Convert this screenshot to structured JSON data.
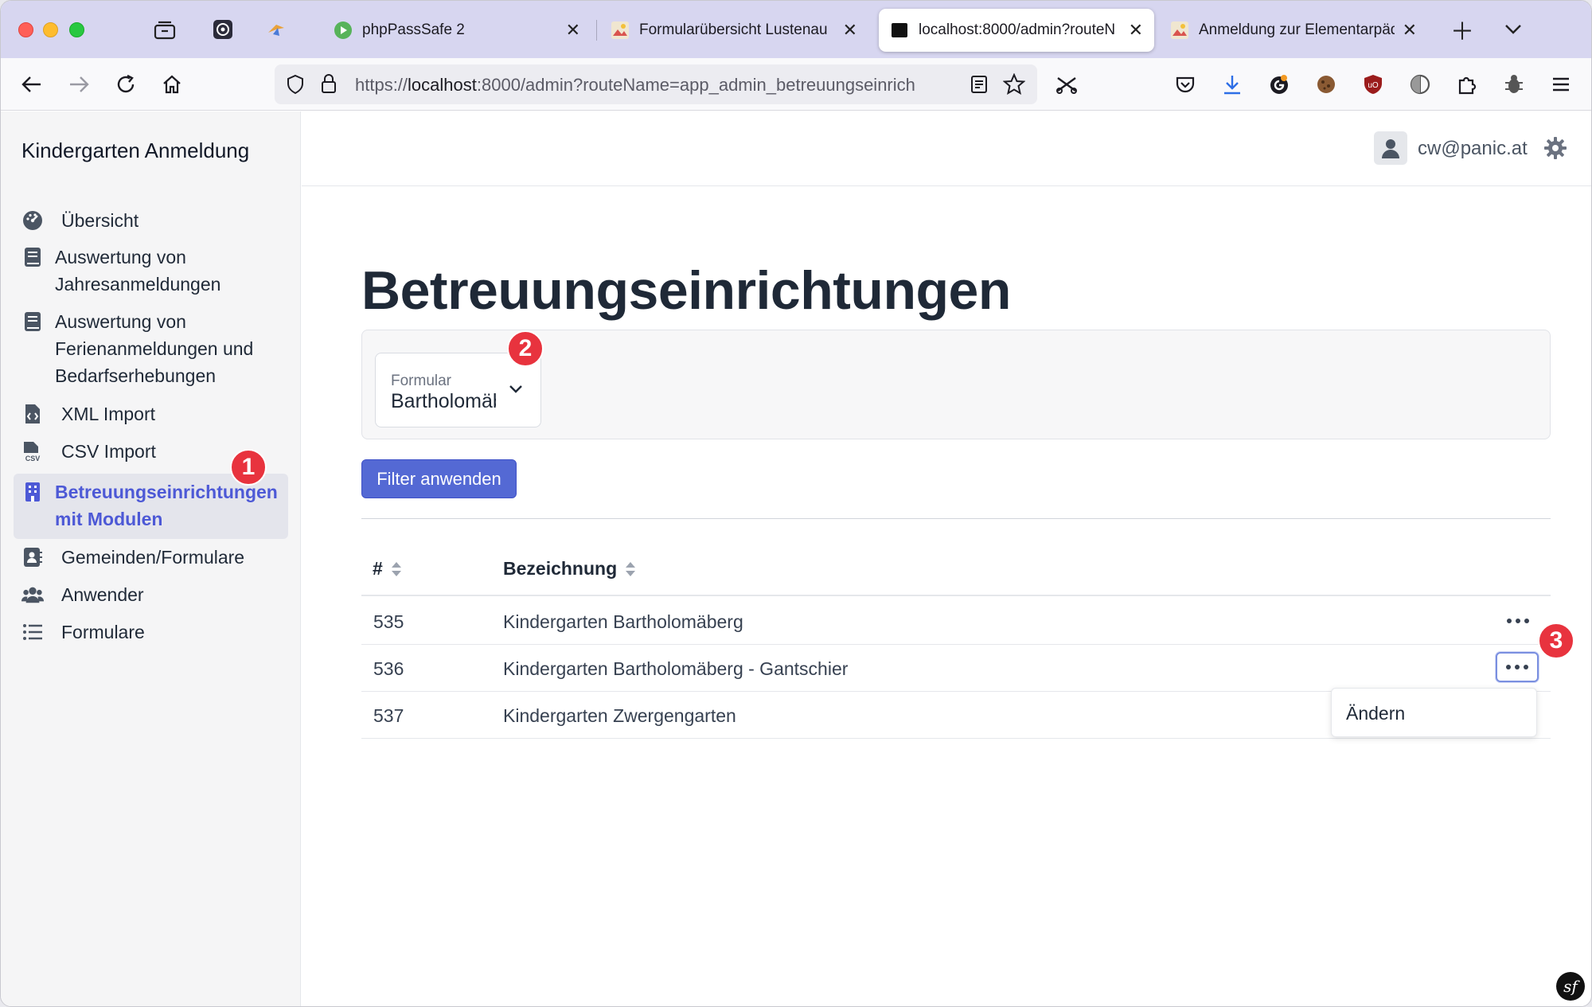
{
  "browser": {
    "tabs": [
      {
        "title": "phpPassSafe 2",
        "favicon": "play-circle-icon"
      },
      {
        "title": "Formularübersicht Lustenau",
        "favicon": "image-icon"
      },
      {
        "title": "localhost:8000/admin?routeN",
        "favicon": "black-square-icon"
      },
      {
        "title": "Anmeldung zur Elementarpäd",
        "favicon": "image-icon"
      }
    ],
    "url_prefix": "https://",
    "url_host": "localhost",
    "url_rest": ":8000/admin?routeName=app_admin_betreuungseinrich"
  },
  "app": {
    "brand": "Kindergarten Anmeldung",
    "user_email": "cw@panic.at"
  },
  "sidebar": {
    "items": [
      {
        "label": "Übersicht",
        "icon": "dashboard-icon"
      },
      {
        "label": "Auswertung von Jahresanmeldungen",
        "icon": "book-icon"
      },
      {
        "label": "Auswertung von Ferienanmeldungen und Bedarfserhebungen",
        "icon": "book-icon"
      },
      {
        "label": "XML Import",
        "icon": "file-code-icon"
      },
      {
        "label": "CSV Import",
        "icon": "file-csv-icon"
      },
      {
        "label": "Betreuungseinrichtungen mit Modulen",
        "icon": "building-icon"
      },
      {
        "label": "Gemeinden/Formulare",
        "icon": "address-book-icon"
      },
      {
        "label": "Anwender",
        "icon": "users-icon"
      },
      {
        "label": "Formulare",
        "icon": "list-icon"
      }
    ]
  },
  "main": {
    "title": "Betreuungseinrichtungen",
    "filter": {
      "label": "Formular",
      "value": "Bartholomäberg"
    },
    "apply_label": "Filter anwenden",
    "table": {
      "headers": [
        "#",
        "Bezeichnung"
      ],
      "rows": [
        {
          "id": "535",
          "name": "Kindergarten Bartholomäberg"
        },
        {
          "id": "536",
          "name": "Kindergarten Bartholomäberg - Gantschier"
        },
        {
          "id": "537",
          "name": "Kindergarten Zwergengarten"
        }
      ]
    },
    "row_menu": {
      "edit_label": "Ändern"
    }
  },
  "annotations": [
    "1",
    "2",
    "3"
  ],
  "colors": {
    "accent": "#5469d4",
    "active_nav": "#4d59d6",
    "badge": "#e8333e"
  }
}
